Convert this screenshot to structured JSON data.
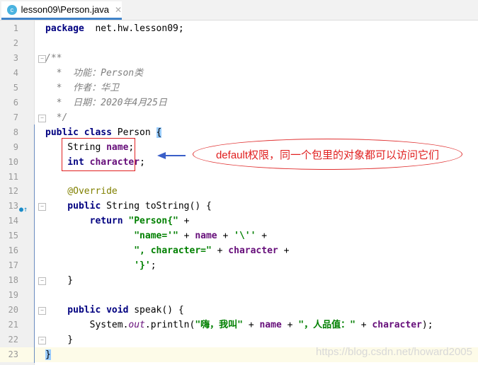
{
  "tab": {
    "title": "lesson09\\Person.java",
    "icon": "class-icon",
    "icon_letter": "c",
    "close": "✕"
  },
  "lines": [
    [
      [
        "kw",
        "package"
      ],
      [
        "",
        "  net.hw.lesson09;"
      ]
    ],
    [],
    [
      [
        "cm",
        "/**"
      ]
    ],
    [
      [
        "cm",
        "  *  功能：Person类"
      ]
    ],
    [
      [
        "cm",
        "  *  作者：华卫"
      ]
    ],
    [
      [
        "cm",
        "  *  日期：2020年4月25日"
      ]
    ],
    [
      [
        "cm",
        "  */"
      ]
    ],
    [
      [
        "kw",
        "public class"
      ],
      [
        "",
        " Person "
      ],
      [
        "brace",
        "{"
      ]
    ],
    [
      [
        "",
        "    String "
      ],
      [
        "fld",
        "name"
      ],
      [
        "",
        ";"
      ]
    ],
    [
      [
        "kw",
        "    int"
      ],
      [
        "",
        " "
      ],
      [
        "fld",
        "character"
      ],
      [
        "",
        ";"
      ]
    ],
    [],
    [
      [
        "ann",
        "    @Override"
      ]
    ],
    [
      [
        "kw",
        "    public"
      ],
      [
        "",
        " String toString() {"
      ]
    ],
    [
      [
        "kw",
        "        return"
      ],
      [
        "",
        " "
      ],
      [
        "str",
        "\"Person{\""
      ],
      [
        "",
        " +"
      ]
    ],
    [
      [
        "str",
        "                \"name='\""
      ],
      [
        "",
        " + "
      ],
      [
        "fld",
        "name"
      ],
      [
        "",
        " + "
      ],
      [
        "str",
        "'\\''"
      ],
      [
        "",
        " +"
      ]
    ],
    [
      [
        "str",
        "                \", character=\""
      ],
      [
        "",
        " + "
      ],
      [
        "fld",
        "character"
      ],
      [
        "",
        " +"
      ]
    ],
    [
      [
        "str",
        "                '}'"
      ],
      [
        "",
        ";"
      ]
    ],
    [
      [
        "",
        "    }"
      ]
    ],
    [],
    [
      [
        "kw",
        "    public void"
      ],
      [
        "",
        " speak() {"
      ]
    ],
    [
      [
        "",
        "        System."
      ],
      [
        "st",
        "out"
      ],
      [
        "",
        ".println("
      ],
      [
        "str",
        "\"嗨，我叫\""
      ],
      [
        "",
        " + "
      ],
      [
        "fld",
        "name"
      ],
      [
        "",
        " + "
      ],
      [
        "str",
        "\"，人品值：\""
      ],
      [
        "",
        " + "
      ],
      [
        "fld",
        "character"
      ],
      [
        "",
        ");"
      ]
    ],
    [
      [
        "",
        "    }"
      ]
    ],
    [
      [
        "brace",
        "}"
      ]
    ]
  ],
  "current_line": 23,
  "fold_lines": [
    3,
    7,
    13,
    18,
    20,
    22
  ],
  "override_line": 13,
  "annotation": {
    "text": "default权限，同一个包里的对象都可以访问它们",
    "color": "#e02020"
  },
  "watermark": "https://blog.csdn.net/howard2005"
}
